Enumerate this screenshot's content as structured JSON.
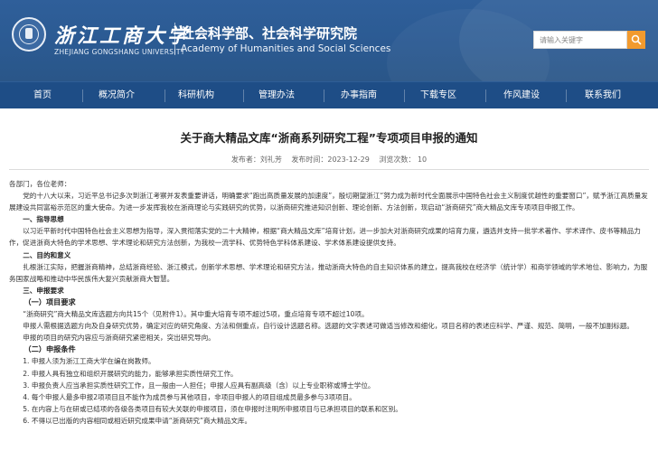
{
  "header": {
    "school_cn": "浙江工商大学",
    "school_en": "ZHEJIANG GONGSHANG UNIVERSITY",
    "dept_cn": "社会科学部、社会科学研究院",
    "dept_en": "Academy of Humanities and Social Sciences",
    "search_placeholder": "请输入关键字",
    "colors": {
      "header_bg": "#2b5a92",
      "nav_bg": "#1e4d86",
      "search_button": "#f29a2e"
    }
  },
  "nav": {
    "items": [
      {
        "label": "首页"
      },
      {
        "label": "概况简介"
      },
      {
        "label": "科研机构"
      },
      {
        "label": "管理办法"
      },
      {
        "label": "办事指南"
      },
      {
        "label": "下载专区"
      },
      {
        "label": "作风建设"
      },
      {
        "label": "联系我们"
      }
    ]
  },
  "article": {
    "title": "关于商大精品文库“浙商系列研究工程”专项项目申报的通知",
    "meta": {
      "publisher": "发布者：刘礼芳",
      "time": "发布时间：2023-12-29",
      "views": "浏览次数：  10"
    },
    "greeting": "各部门，各位老师：",
    "intro": "党的十八大以来，习近平总书记多次到浙江考察并发表重要讲话，明确要求“跑出高质量发展的加速度”，殷切期望浙江“努力成为新时代全面展示中国特色社会主义制度优越性的重要窗口”，赋予浙江高质量发展建设共同富裕示范区的重大使命。为进一步发挥我校在浙商理论与实践研究的优势，以浙商研究推进知识创新、理论创新、方法创新，现启动“浙商研究”商大精品文库专项项目申报工作。",
    "section1_head": "一、指导思想",
    "section1_text": "以习近平新时代中国特色社会主义思想为指导，深入贯彻落实党的二十大精神，根据“商大精品文库”培育计划，进一步加大对浙商研究成果的培育力度，遴选并支持一批学术著作、学术译作、皮书等精品力作，促进浙商大特色的学术思想、学术理论和研究方法创新，为我校一流学科、优势特色学科体系建设、学术体系建设提供支持。",
    "section2_head": "二、目的和意义",
    "section2_text": "扎根浙江实际，把握浙商精神，总结浙商经验、浙江模式，创新学术思想、学术理论和研究方法，推动浙商大特色的自主知识体系的建立，提高我校在经济学（统计学）和商学领域的学术地位、影响力，为服务国家战略和推动中华民族伟大复兴贡献浙商大智慧。",
    "section3_head": "三、申报要求",
    "sub1_head": "（一）项目要求",
    "sub1_p1": "“浙商研究”商大精品文库选题方向共15个（见附件1）。其中重大培育专项不超过5项，重点培育专项不超过10项。",
    "sub1_p2": "申报人需根据选题方向及自身研究优势，确定对应的研究角度、方法和侧重点，自行设计选题名称。选题的文字表述可做适当修改和细化，项目名称的表述应科学、严谨、规范、简明，一般不加副标题。",
    "sub1_p3": "申报的项目的研究内容应与浙商研究紧密相关，突出研究导向。",
    "sub2_head": "（二）申报条件",
    "conditions": [
      "1.  申报人须为浙江工商大学在编在岗教师。",
      "2.  申报人具有独立和组织开展研究的能力，能够承担实质性研究工作。",
      "3.  申报负责人应当承担实质性研究工作，且一般由一人担任；申报人应具有副高级（含）以上专业职称或博士学位。",
      "4.  每个申报人最多申报2项项目且不能作为成员参与其他项目，非项目申报人的项目组成员最多参与3项项目。",
      "5.  在内容上与在研或已结项的各级各类项目有较大关联的申报项目，须在申报时注明所申报项目与已承担项目的联系和区别。",
      "6.  不得以已出版的内容相同或相近研究成果申请“浙商研究”商大精品文库。"
    ]
  }
}
